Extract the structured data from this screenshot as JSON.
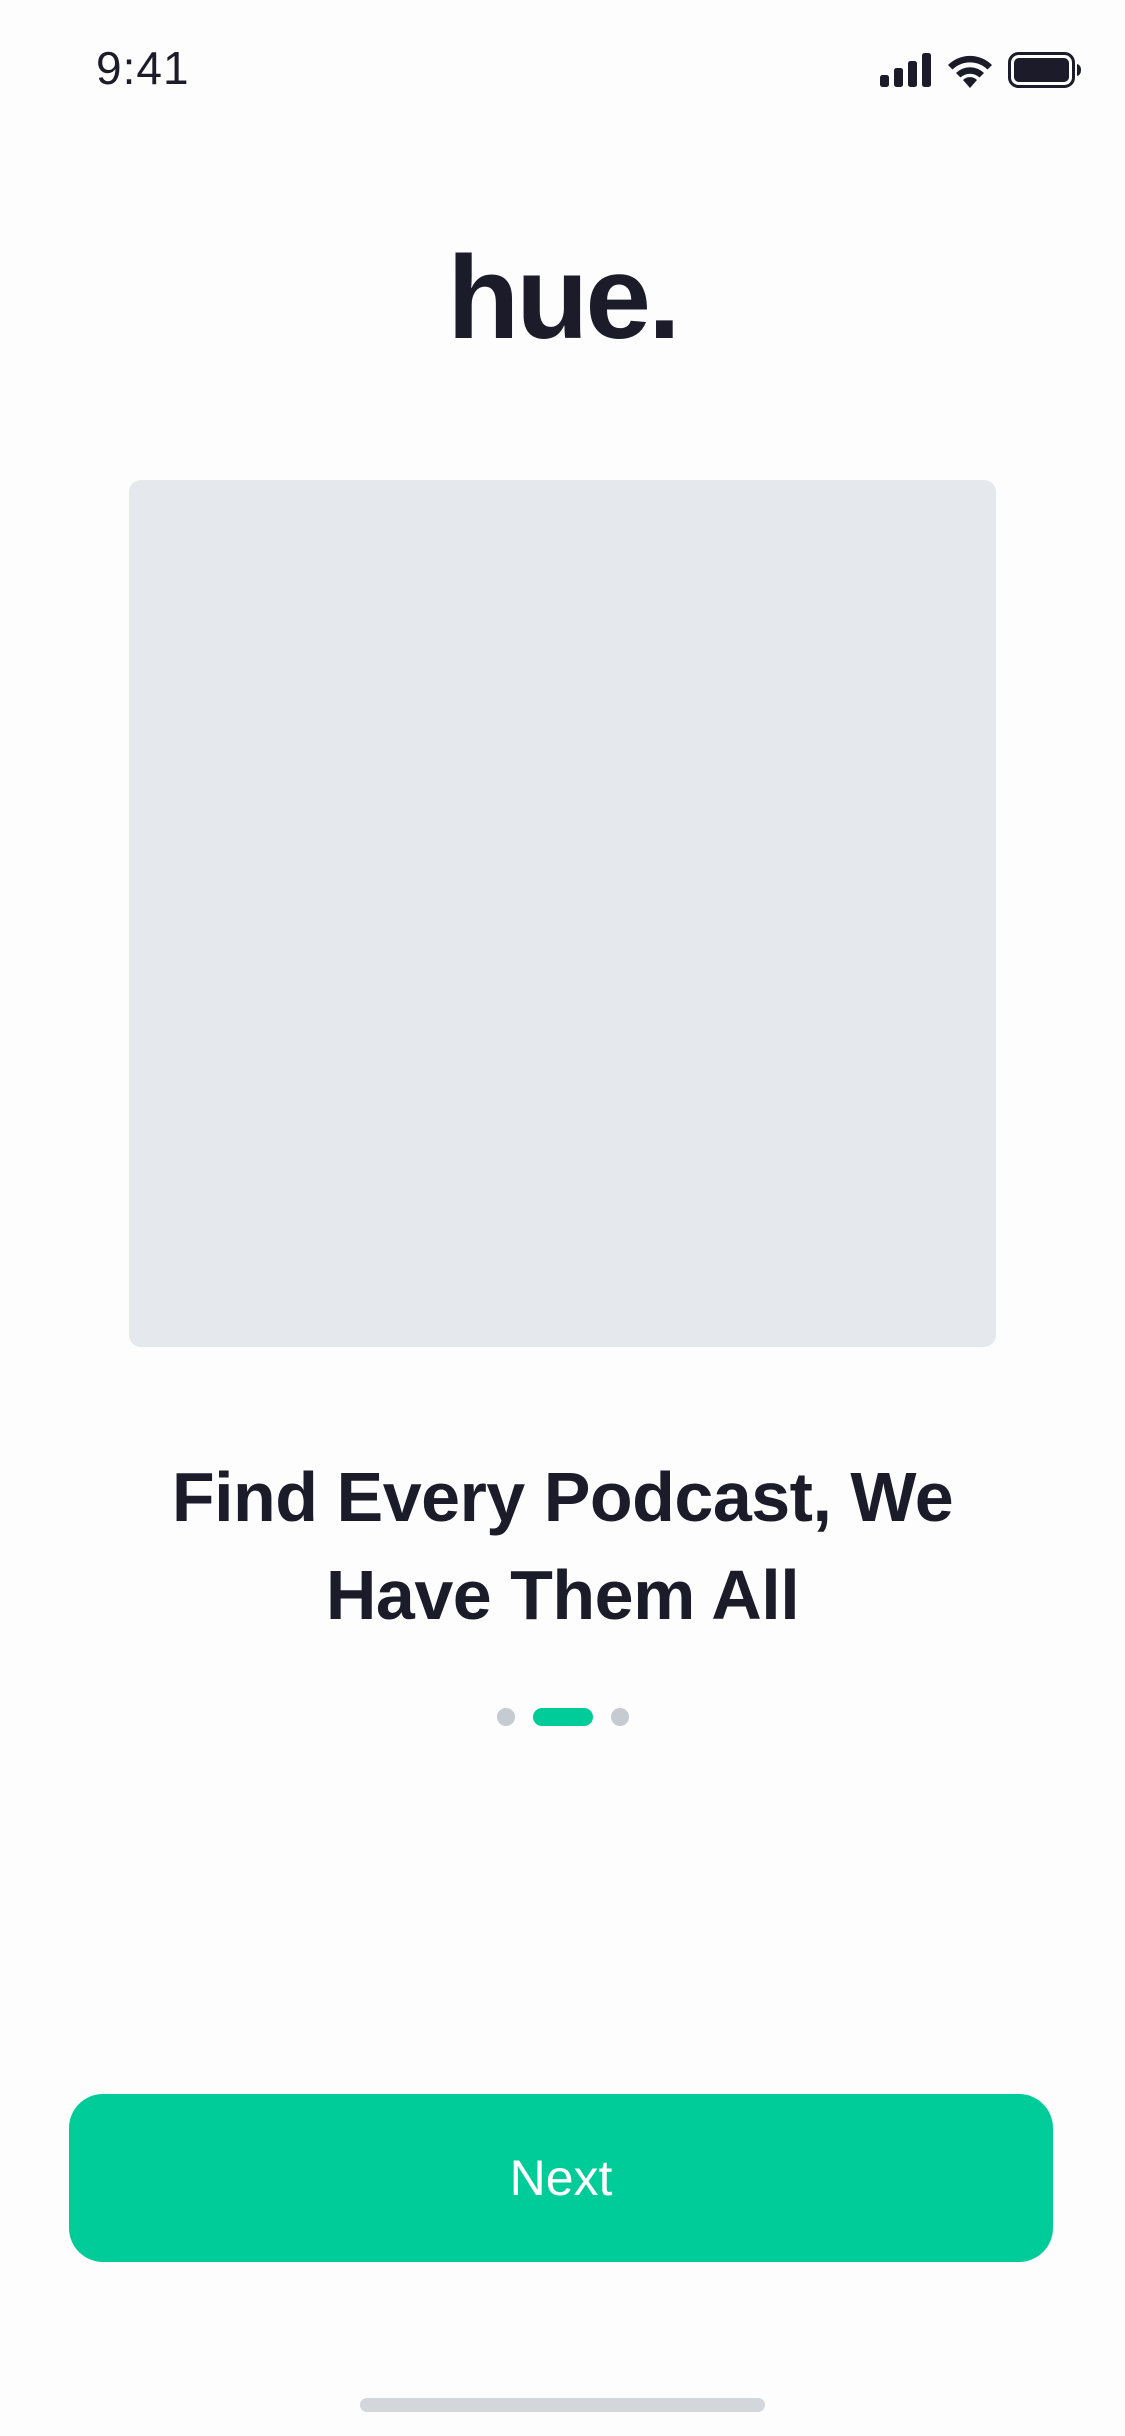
{
  "status_bar": {
    "time": "9:41",
    "icons": [
      "cellular-signal-icon",
      "wifi-icon",
      "battery-icon"
    ]
  },
  "logo": {
    "text": "hue."
  },
  "hero_image": {
    "kind": "image-placeholder"
  },
  "onboarding": {
    "headline": "Find Every Podcast, We Have Them All",
    "pager": {
      "total_pages": 3,
      "current_page": 2
    }
  },
  "actions": {
    "next_label": "Next"
  },
  "colors": {
    "accent": "#00CC99",
    "text": "#1B1B2A",
    "placeholder": "#E5E9ED",
    "dot_inactive": "#C5CBD1",
    "background": "#FDFDFD"
  }
}
